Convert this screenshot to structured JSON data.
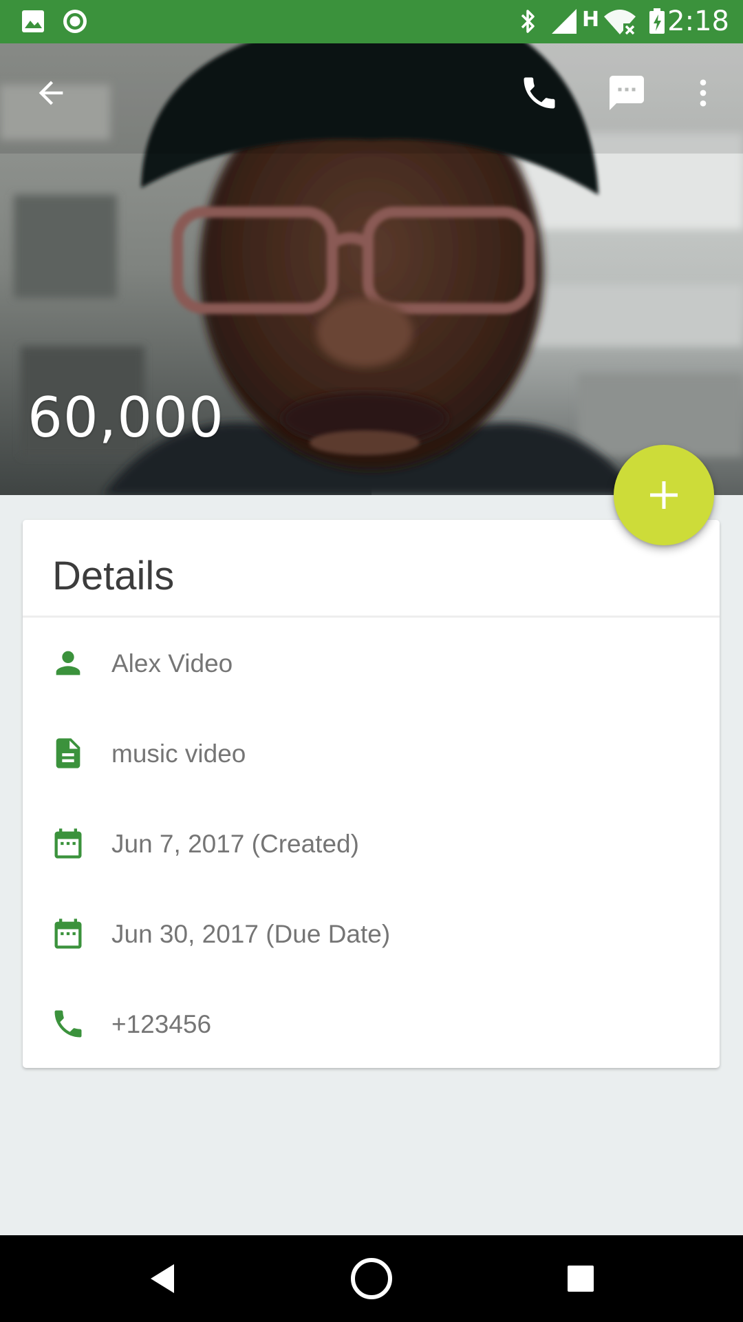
{
  "status_bar": {
    "time": "2:18",
    "background_color": "#3b923c",
    "left_icons": [
      "image-notification-icon",
      "record-notification-icon"
    ],
    "right_icons": [
      "bluetooth-icon",
      "cell-signal-icon",
      "network-type-h-icon",
      "wifi-no-internet-icon",
      "battery-charging-icon"
    ],
    "network_type": "H"
  },
  "header": {
    "title": "60,000",
    "toolbar_icons": [
      "back-arrow-icon",
      "phone-icon",
      "message-icon",
      "more-vert-icon"
    ]
  },
  "fab": {
    "icon": "plus-icon",
    "color": "#cddc39"
  },
  "details": {
    "title": "Details",
    "icon_color": "#3b923c",
    "rows": [
      {
        "icon": "person-icon",
        "text": "Alex Video"
      },
      {
        "icon": "document-icon",
        "text": "music video"
      },
      {
        "icon": "calendar-icon",
        "text": "Jun 7, 2017 (Created)"
      },
      {
        "icon": "calendar-icon",
        "text": "Jun 30, 2017 (Due Date)"
      },
      {
        "icon": "phone-icon",
        "text": "+123456"
      }
    ]
  },
  "nav_bar": {
    "buttons": [
      "back-triangle-icon",
      "home-circle-icon",
      "recents-square-icon"
    ]
  }
}
